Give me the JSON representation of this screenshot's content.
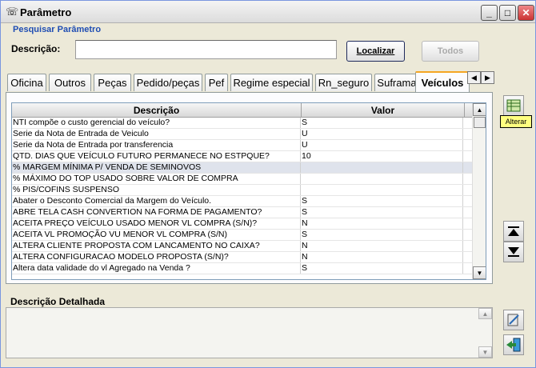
{
  "window": {
    "title": "Parâmetro",
    "minimize": "_",
    "maximize": "□",
    "close": "✕"
  },
  "search": {
    "heading": "Pesquisar Parâmetro",
    "description_label": "Descrição:",
    "description_value": "",
    "locate_button": "Localizar",
    "all_button": "Todos"
  },
  "tabs": [
    {
      "label": "Oficina"
    },
    {
      "label": "Outros"
    },
    {
      "label": "Peças"
    },
    {
      "label": "Pedido/peças"
    },
    {
      "label": "Pef"
    },
    {
      "label": "Regime especial"
    },
    {
      "label": "Rn_seguro"
    },
    {
      "label": "Suframa"
    },
    {
      "label": "Veículos",
      "active": true
    }
  ],
  "grid": {
    "headers": {
      "description": "Descrição",
      "value": "Valor"
    },
    "rows": [
      {
        "description": "NTI compõe o custo gerencial do veículo?",
        "value": "S"
      },
      {
        "description": "Serie da Nota de Entrada de Veiculo",
        "value": "U"
      },
      {
        "description": "Serie da Nota de Entrada por transferencia",
        "value": "U"
      },
      {
        "description": "QTD. DIAS QUE VEÍCULO FUTURO PERMANECE NO ESTPQUE?",
        "value": "10"
      },
      {
        "description": "% MARGEM MÍNIMA P/ VENDA DE SEMINOVOS",
        "value": ""
      },
      {
        "description": "% MÁXIMO DO TOP USADO SOBRE VALOR DE COMPRA",
        "value": ""
      },
      {
        "description": "% PIS/COFINS SUSPENSO",
        "value": ""
      },
      {
        "description": "Abater o Desconto Comercial da Margem do Veículo.",
        "value": "S"
      },
      {
        "description": "ABRE TELA CASH CONVERTION NA FORMA DE PAGAMENTO?",
        "value": "S"
      },
      {
        "description": "ACEITA PREÇO VEÍCULO USADO MENOR VL COMPRA (S/N)?",
        "value": "N"
      },
      {
        "description": "ACEITA VL PROMOÇÃO VU MENOR VL COMPRA (S/N)",
        "value": "S"
      },
      {
        "description": "ALTERA CLIENTE PROPOSTA COM LANCAMENTO NO CAIXA?",
        "value": "N"
      },
      {
        "description": "ALTERA CONFIGURACAO MODELO PROPOSTA (S/N)?",
        "value": "N"
      },
      {
        "description": "Altera data validade do vl Agregado na Venda ?",
        "value": "S"
      }
    ]
  },
  "tooltip": "Alterar",
  "detail": {
    "label": "Descrição Detalhada",
    "value": ""
  },
  "icons": {
    "window": "phone-icon",
    "edit": "grid-edit-icon",
    "first": "first-record-icon",
    "last": "last-record-icon",
    "report": "report-icon",
    "exit": "exit-icon"
  }
}
